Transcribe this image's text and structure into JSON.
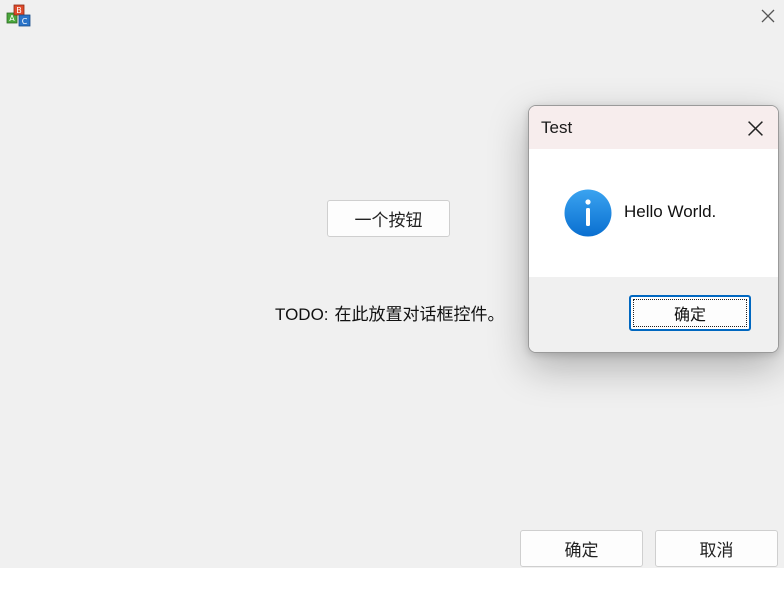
{
  "main_window": {
    "one_button_label": "一个按钮",
    "todo_key": "TODO:",
    "todo_text": "在此放置对话框控件。",
    "ok_label": "确定",
    "cancel_label": "取消"
  },
  "message_box": {
    "title": "Test",
    "message": "Hello World.",
    "ok_label": "确定"
  },
  "icons": {
    "app": "app-blocks-icon",
    "close": "close-icon",
    "info": "info-icon"
  },
  "colors": {
    "accent": "#0067c0",
    "info_blue": "#1a88e2",
    "dialog_title_bg": "#f7eded",
    "window_bg": "#f0f0f0"
  }
}
